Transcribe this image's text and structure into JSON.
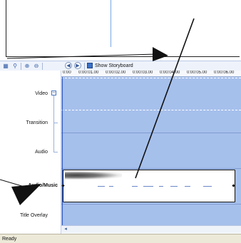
{
  "toolbar": {
    "icons": [
      "storyboard-icon",
      "wand-icon",
      "zoom-in-icon",
      "zoom-out-icon",
      "rewind-icon",
      "play-icon"
    ],
    "show_storyboard": "Show Storyboard"
  },
  "tracks": {
    "video": "Video",
    "transition": "Transition",
    "audio": "Audio",
    "audio_music": "Audio/Music",
    "title_overlay": "Title Overlay"
  },
  "ruler": {
    "ticks": [
      "0:00",
      "0:00:01.00",
      "0:00:02.00",
      "0:00:03.00",
      "0:00:04.00",
      "0:00:05.00",
      "0:00:06.00"
    ]
  },
  "status": {
    "text": "Ready"
  },
  "colors": {
    "timeline": "#a6c0ec",
    "annotation_arrows": "#111111"
  }
}
